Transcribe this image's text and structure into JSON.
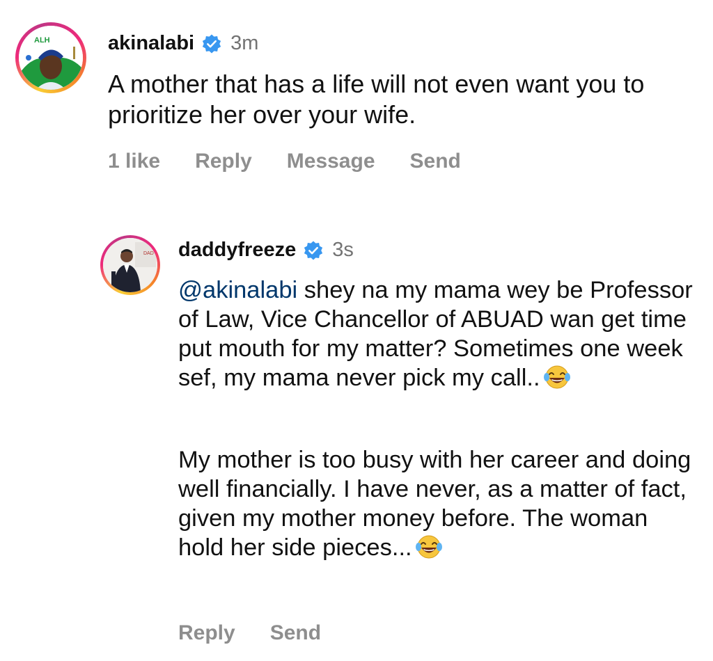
{
  "comments": [
    {
      "username": "akinalabi",
      "time": "3m",
      "avatar_badge": "ALH",
      "text": "A mother that has a life will not even want you to prioritize her over your wife.",
      "likes": "1 like",
      "reply": "Reply",
      "message": "Message",
      "send": "Send"
    },
    {
      "username": "daddyfreeze",
      "time": "3s",
      "mention": "@akinalabi",
      "paragraph1": " shey na my mama wey be Professor of Law, Vice Chancellor of ABUAD wan get time put mouth for my matter? Sometimes one week sef, my mama never pick my call..",
      "paragraph2": "My mother is too busy with her career and doing well financially. I have never, as a matter of fact, given my mother money before. The woman hold her side pieces...",
      "reply": "Reply",
      "send": "Send"
    }
  ],
  "colors": {
    "verified": "#3897f0",
    "mention": "#00376b",
    "muted": "#8e8e8e"
  },
  "icons": [
    "verified-badge-icon",
    "laughing-emoji-icon"
  ]
}
